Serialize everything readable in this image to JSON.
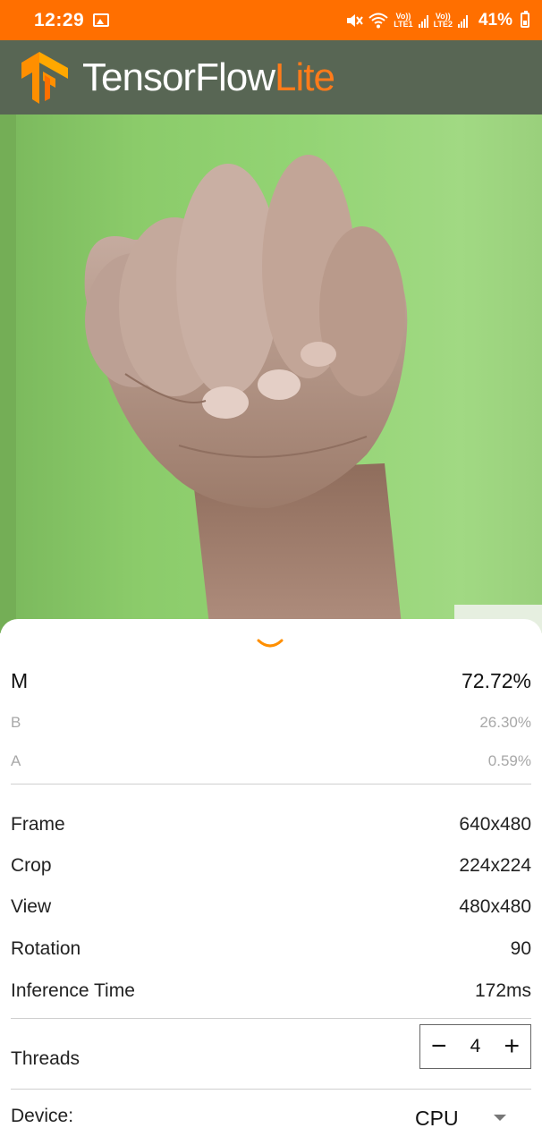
{
  "status_bar": {
    "time": "12:29",
    "sim1": {
      "top": "Vo))",
      "bottom": "LTE1"
    },
    "sim2": {
      "top": "Vo))",
      "bottom": "LTE2"
    },
    "battery": "41%",
    "battery_level": 0.41,
    "color": "#ff6f00"
  },
  "app_bar": {
    "brand_main": "TensorFlow",
    "brand_accent": "Lite",
    "logo_icon": "tensorflow-logo",
    "background": "#586654",
    "accent_color": "#ff7b1a"
  },
  "results": [
    {
      "label": "M",
      "value": "72.72%"
    },
    {
      "label": "B",
      "value": "26.30%"
    },
    {
      "label": "A",
      "value": "0.59%"
    }
  ],
  "info": [
    {
      "label": "Frame",
      "value": "640x480"
    },
    {
      "label": "Crop",
      "value": "224x224"
    },
    {
      "label": "View",
      "value": "480x480"
    },
    {
      "label": "Rotation",
      "value": "90"
    },
    {
      "label": "Inference Time",
      "value": "172ms"
    }
  ],
  "threads": {
    "label": "Threads",
    "minus": "−",
    "value": "4",
    "plus": "+"
  },
  "device": {
    "label": "Device:",
    "value": "CPU"
  }
}
